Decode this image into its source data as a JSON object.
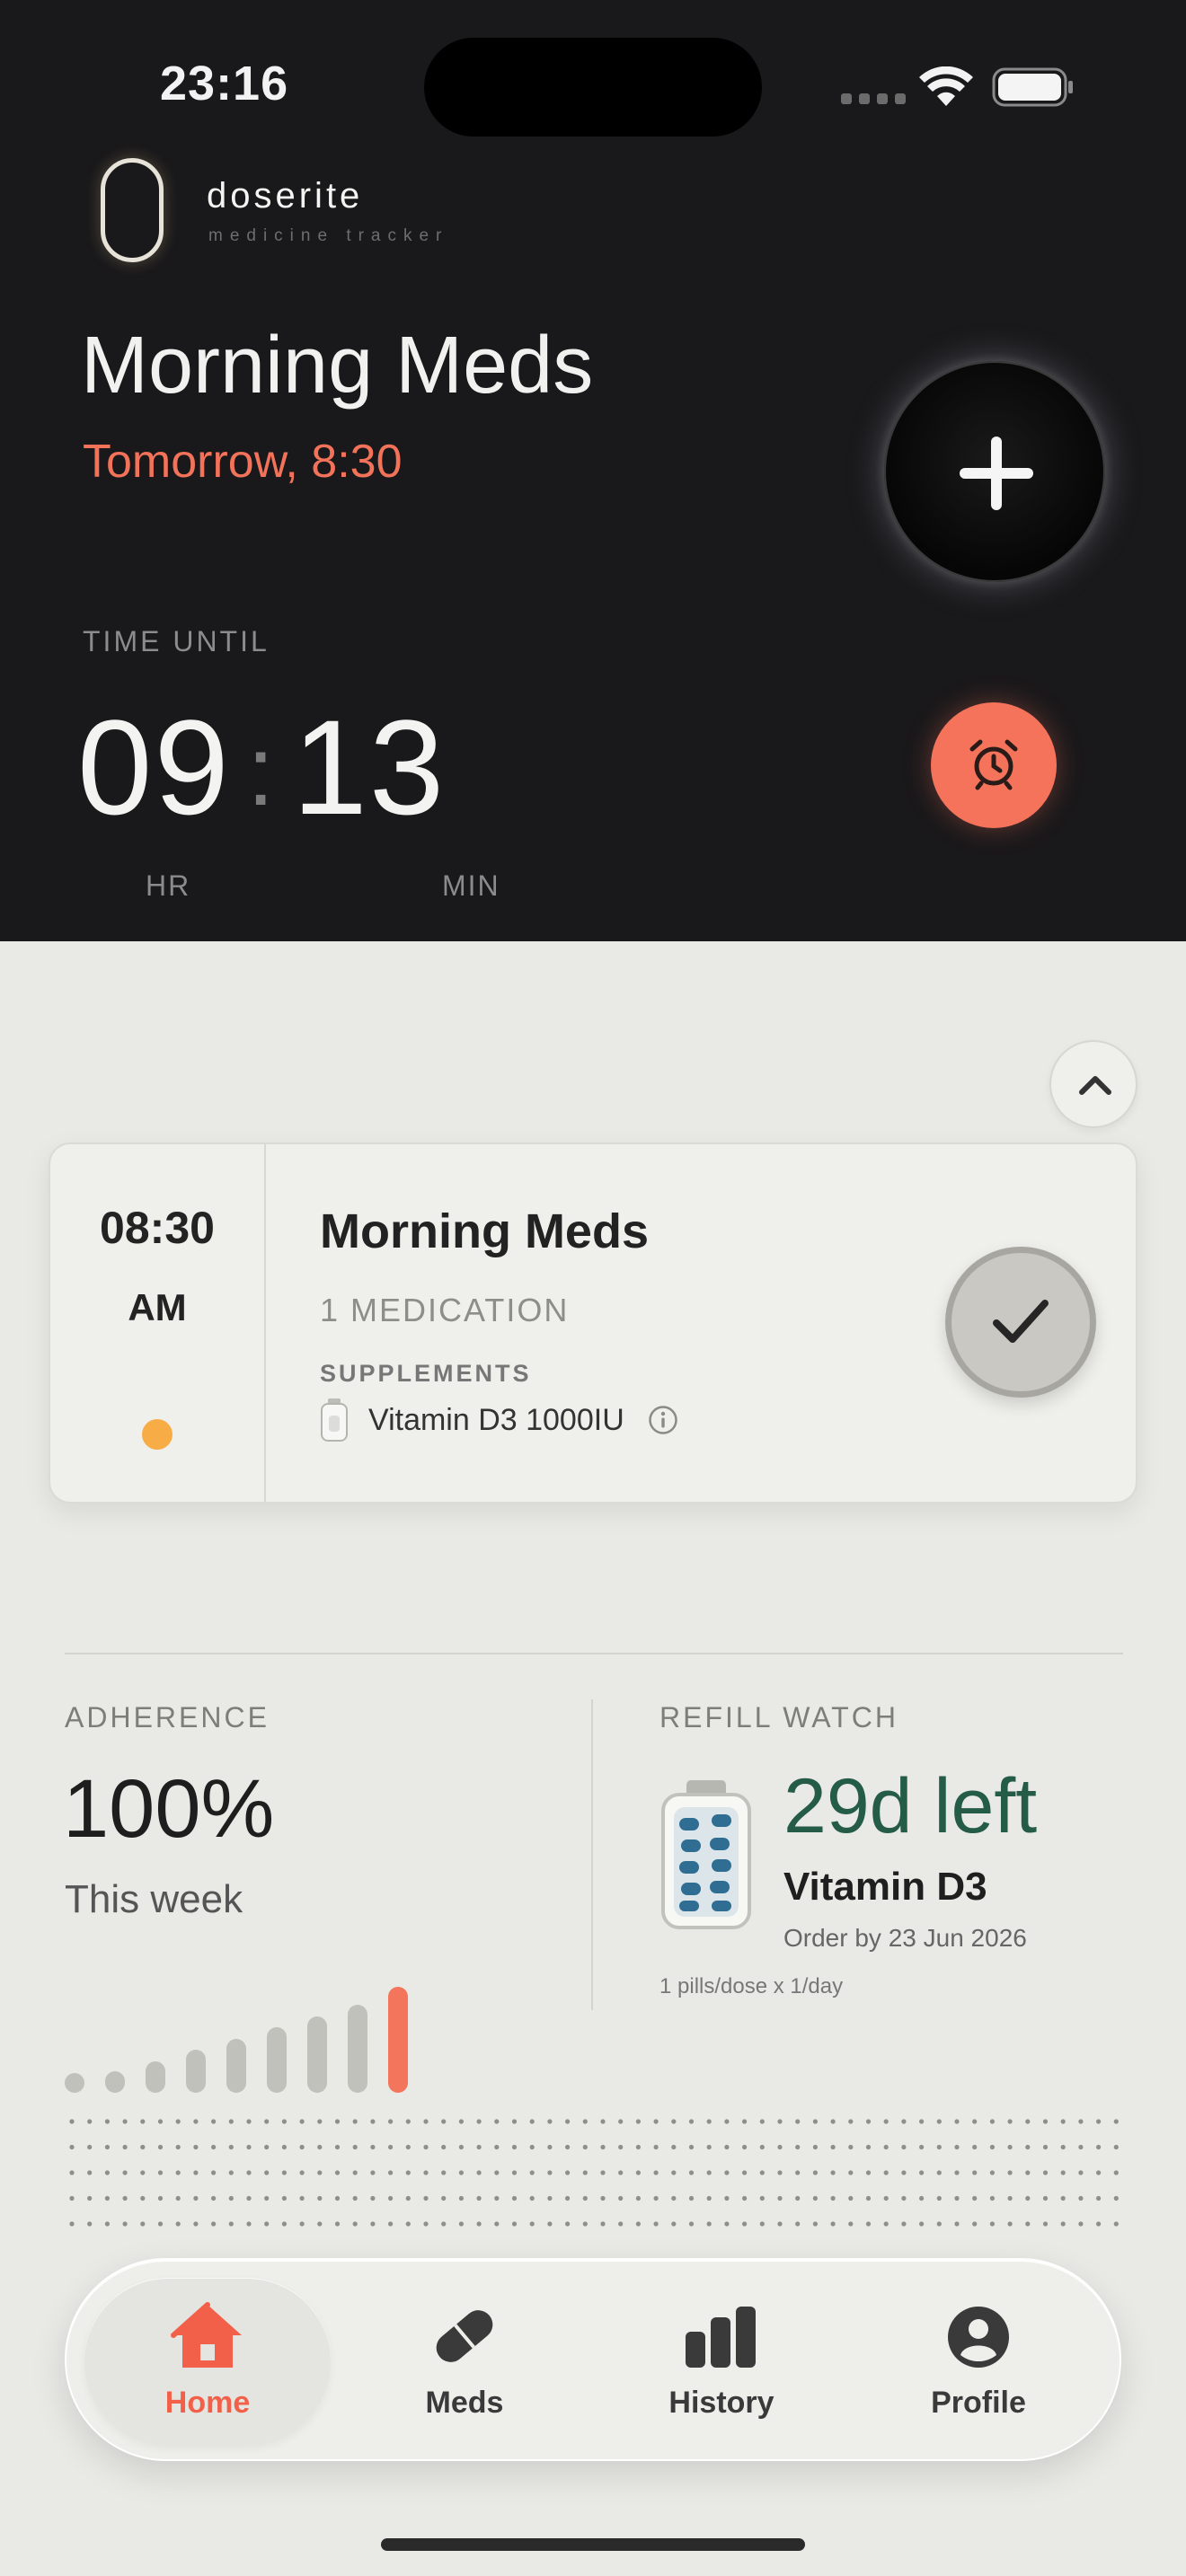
{
  "status_bar": {
    "time": "23:16"
  },
  "brand": {
    "name": "doserite",
    "tagline": "medicine tracker"
  },
  "hero": {
    "title": "Morning Meds",
    "subtitle": "Tomorrow, 8:30",
    "time_until_label": "TIME UNTIL",
    "hours": "09",
    "minutes": "13",
    "hours_unit": "HR",
    "minutes_unit": "MIN"
  },
  "dose_card": {
    "time": "08:30",
    "ampm": "AM",
    "title": "Morning Meds",
    "count": "1 MEDICATION",
    "category": "SUPPLEMENTS",
    "medication": "Vitamin D3 1000IU",
    "status_dot_color": "#f8ac45"
  },
  "adherence": {
    "label": "ADHERENCE",
    "value": "100%",
    "period": "This week",
    "trend_fraction": [
      0.09,
      0.2,
      0.3,
      0.41,
      0.51,
      0.62,
      0.72,
      0.83,
      1.0
    ]
  },
  "refill": {
    "label": "REFILL WATCH",
    "days_left": "29d left",
    "medication": "Vitamin D3",
    "order_by": "Order by 23 Jun 2026",
    "dosage": "1 pills/dose x 1/day"
  },
  "tabs": [
    {
      "label": "Home",
      "icon": "home-icon",
      "active": true
    },
    {
      "label": "Meds",
      "icon": "pill-icon",
      "active": false
    },
    {
      "label": "History",
      "icon": "bar-chart-icon",
      "active": false
    },
    {
      "label": "Profile",
      "icon": "profile-icon",
      "active": false
    }
  ],
  "colors": {
    "accent": "#f5735b",
    "refill_green": "#245c48",
    "hero_bg": "#19181a",
    "page_bg": "#e9e9e5"
  }
}
